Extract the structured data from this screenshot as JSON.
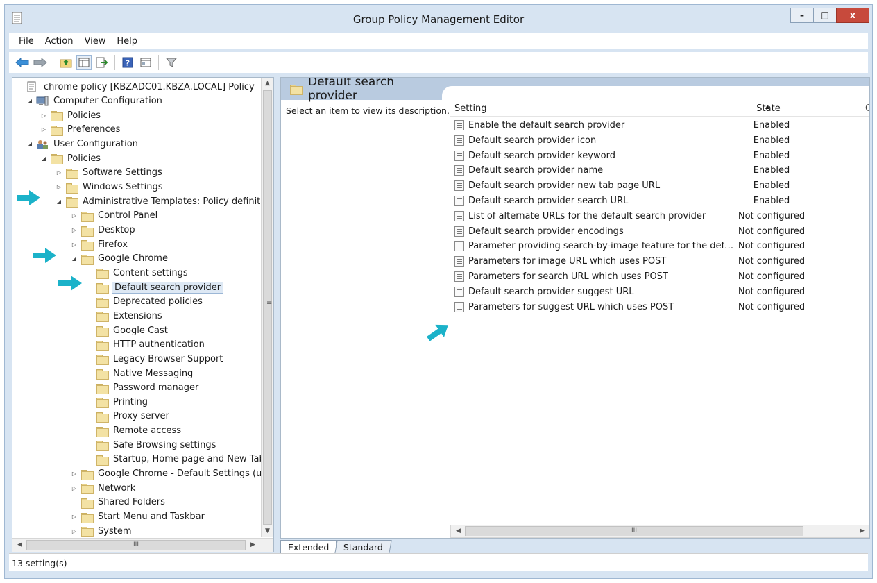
{
  "window": {
    "title": "Group Policy Management Editor",
    "minimize": "–",
    "maximize": "□",
    "close": "x"
  },
  "menu": [
    "File",
    "Action",
    "View",
    "Help"
  ],
  "toolbar": [
    "back-icon",
    "forward-icon",
    "up-folder-icon",
    "show-hide-tree-icon",
    "export-list-icon",
    "help-icon",
    "properties-icon",
    "filter-icon"
  ],
  "tree": {
    "nodes": [
      {
        "label": "chrome policy [KBZADC01.KBZA.LOCAL] Policy",
        "expander": "",
        "icon": "policy-doc-icon"
      },
      {
        "label": "Computer Configuration",
        "expander": "◢",
        "icon": "computer-icon"
      },
      {
        "label": "Policies",
        "expander": "▷",
        "icon": "folder-icon"
      },
      {
        "label": "Preferences",
        "expander": "▷",
        "icon": "folder-icon"
      },
      {
        "label": "User Configuration",
        "expander": "◢",
        "icon": "users-icon"
      },
      {
        "label": "Policies",
        "expander": "◢",
        "icon": "folder-icon"
      },
      {
        "label": "Software Settings",
        "expander": "▷",
        "icon": "folder-icon"
      },
      {
        "label": "Windows Settings",
        "expander": "▷",
        "icon": "folder-icon"
      },
      {
        "label": "Administrative Templates: Policy definitions",
        "expander": "◢",
        "icon": "folder-icon"
      },
      {
        "label": "Control Panel",
        "expander": "▷",
        "icon": "folder-icon"
      },
      {
        "label": "Desktop",
        "expander": "▷",
        "icon": "folder-icon"
      },
      {
        "label": "Firefox",
        "expander": "▷",
        "icon": "folder-icon"
      },
      {
        "label": "Google Chrome",
        "expander": "◢",
        "icon": "folder-icon"
      },
      {
        "label": "Content settings",
        "expander": "",
        "icon": "folder-icon"
      },
      {
        "label": "Default search provider",
        "expander": "",
        "icon": "folder-icon",
        "selected": true
      },
      {
        "label": "Deprecated policies",
        "expander": "",
        "icon": "folder-icon"
      },
      {
        "label": "Extensions",
        "expander": "",
        "icon": "folder-icon"
      },
      {
        "label": "Google Cast",
        "expander": "",
        "icon": "folder-icon"
      },
      {
        "label": "HTTP authentication",
        "expander": "",
        "icon": "folder-icon"
      },
      {
        "label": "Legacy Browser Support",
        "expander": "",
        "icon": "folder-icon"
      },
      {
        "label": "Native Messaging",
        "expander": "",
        "icon": "folder-icon"
      },
      {
        "label": "Password manager",
        "expander": "",
        "icon": "folder-icon"
      },
      {
        "label": "Printing",
        "expander": "",
        "icon": "folder-icon"
      },
      {
        "label": "Proxy server",
        "expander": "",
        "icon": "folder-icon"
      },
      {
        "label": "Remote access",
        "expander": "",
        "icon": "folder-icon"
      },
      {
        "label": "Safe Browsing settings",
        "expander": "",
        "icon": "folder-icon"
      },
      {
        "label": "Startup, Home page and New Tab page",
        "expander": "",
        "icon": "folder-icon"
      },
      {
        "label": "Google Chrome - Default Settings (users can override)",
        "expander": "▷",
        "icon": "folder-icon"
      },
      {
        "label": "Network",
        "expander": "▷",
        "icon": "folder-icon"
      },
      {
        "label": "Shared Folders",
        "expander": "",
        "icon": "folder-icon"
      },
      {
        "label": "Start Menu and Taskbar",
        "expander": "▷",
        "icon": "folder-icon"
      },
      {
        "label": "System",
        "expander": "▷",
        "icon": "folder-icon"
      }
    ],
    "scroll_grip": "≡",
    "h_grip": "III"
  },
  "right": {
    "header_title": "Default search provider",
    "description": "Select an item to view its description.",
    "columns": {
      "setting": "Setting",
      "state": "State",
      "comment": "C"
    },
    "rows": [
      {
        "setting": "Enable the default search provider",
        "state": "Enabled"
      },
      {
        "setting": "Default search provider icon",
        "state": "Enabled"
      },
      {
        "setting": "Default search provider keyword",
        "state": "Enabled"
      },
      {
        "setting": "Default search provider name",
        "state": "Enabled"
      },
      {
        "setting": "Default search provider new tab page URL",
        "state": "Enabled"
      },
      {
        "setting": "Default search provider search URL",
        "state": "Enabled"
      },
      {
        "setting": "List of alternate URLs for the default search provider",
        "state": "Not configured"
      },
      {
        "setting": "Default search provider encodings",
        "state": "Not configured"
      },
      {
        "setting": "Parameter providing search-by-image feature for the defaul...",
        "state": "Not configured"
      },
      {
        "setting": "Parameters for image URL which uses POST",
        "state": "Not configured"
      },
      {
        "setting": "Parameters for search URL which uses POST",
        "state": "Not configured"
      },
      {
        "setting": "Default search provider suggest URL",
        "state": "Not configured"
      },
      {
        "setting": "Parameters for suggest URL which uses POST",
        "state": "Not configured"
      }
    ],
    "h_grip": "III"
  },
  "tabs": [
    "Extended",
    "Standard"
  ],
  "status": {
    "text": "13 setting(s)"
  },
  "colors": {
    "accent_arrow": "#1bb2c9",
    "header_band": "#b9cbe0",
    "window_frame": "#d7e4f2"
  }
}
